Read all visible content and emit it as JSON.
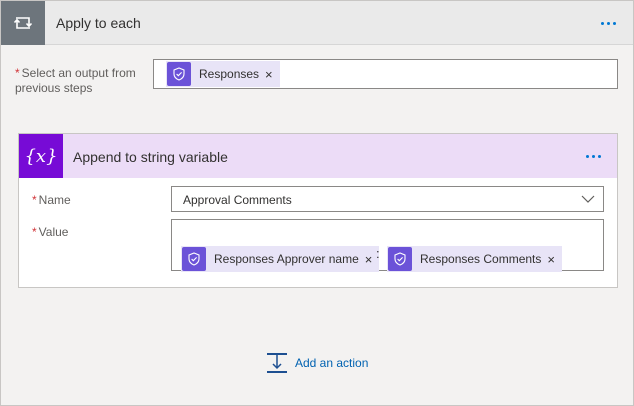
{
  "apply_to_each": {
    "title": "Apply to each",
    "icon": "loop-icon",
    "more_icon": "more-options-icon",
    "select_output": {
      "required_mark": "*",
      "label": "Select an output from previous steps",
      "tokens": [
        {
          "label": "Responses",
          "icon": "approvals-icon",
          "remove": "×"
        }
      ]
    }
  },
  "append_variable": {
    "title": "Append to string variable",
    "icon_glyph": "{x}",
    "more_icon": "more-options-icon",
    "name_field": {
      "required_mark": "*",
      "label": "Name",
      "value": "Approval Comments",
      "icon": "chevron-down-icon"
    },
    "value_field": {
      "required_mark": "*",
      "label": "Value",
      "separator": ":",
      "tokens": [
        {
          "label": "Responses Approver name",
          "icon": "approvals-icon",
          "remove": "×"
        },
        {
          "label": "Responses Comments",
          "icon": "approvals-icon",
          "remove": "×"
        }
      ]
    }
  },
  "add_action": {
    "label": "Add an action",
    "icon": "add-action-icon"
  },
  "colors": {
    "loop_header_bg": "#eaeaea",
    "loop_icon_bg": "#6d757c",
    "variable_header_bg": "#ecdcf7",
    "variable_icon_bg": "#770bd6",
    "token_bg": "#e8e4f7",
    "token_icon_bg": "#6b52d8",
    "link": "#0062b1",
    "required": "#d13438"
  }
}
